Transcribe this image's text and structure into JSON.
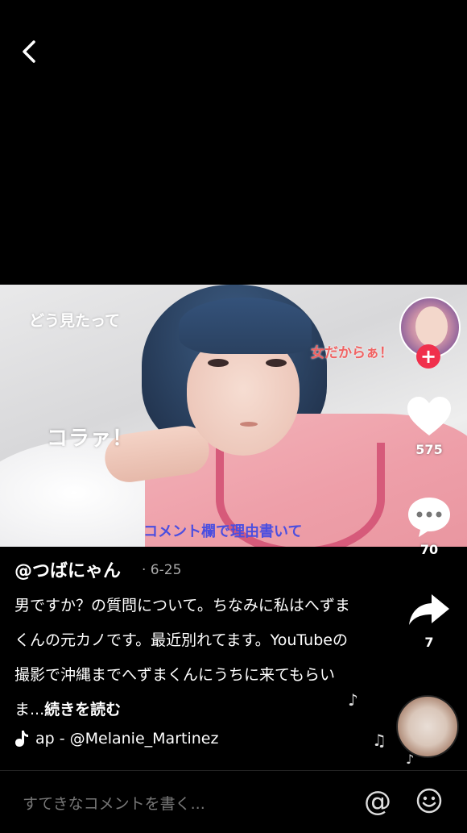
{
  "video": {
    "overlay_texts": [
      "どう見たって",
      "女だからぁ！",
      "コラァ！",
      "コメント欄で理由書いて"
    ]
  },
  "actions": {
    "like_count": "575",
    "comment_count": "70",
    "share_count": "7"
  },
  "post": {
    "username": "@つばにゃん",
    "date": "· 6-25",
    "caption": "男ですか？の質問について。ちなみに私はへずまくんの元カノです。最近別れてます。YouTubeの撮影で沖縄までへずまくんにうちに来てもらいま...",
    "read_more": "続きを読む",
    "music": "ap - @Melanie_Martinez"
  },
  "comment_bar": {
    "placeholder": "すてきなコメントを書く..."
  },
  "colors": {
    "follow_plus": "#f0304c",
    "overlay_blue": "#4b4ee0",
    "overlay_red": "#f06262"
  }
}
